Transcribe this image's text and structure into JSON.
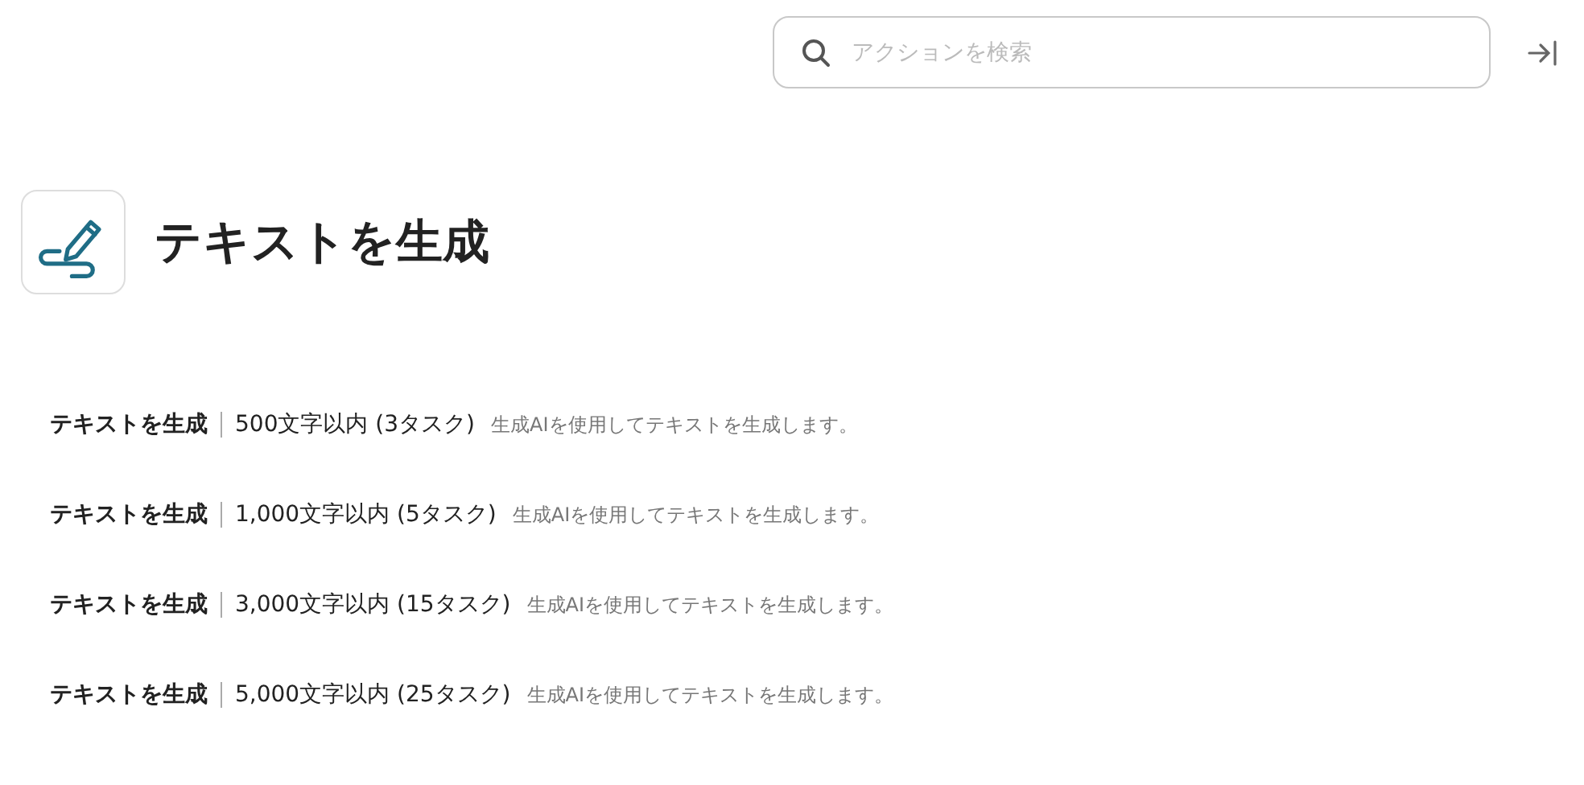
{
  "search": {
    "placeholder": "アクションを検索"
  },
  "header": {
    "title": "テキストを生成"
  },
  "actions": [
    {
      "name": "テキストを生成",
      "detail": "500文字以内 (3タスク)",
      "description": "生成AIを使用してテキストを生成します。"
    },
    {
      "name": "テキストを生成",
      "detail": "1,000文字以内 (5タスク)",
      "description": "生成AIを使用してテキストを生成します。"
    },
    {
      "name": "テキストを生成",
      "detail": "3,000文字以内 (15タスク)",
      "description": "生成AIを使用してテキストを生成します。"
    },
    {
      "name": "テキストを生成",
      "detail": "5,000文字以内 (25タスク)",
      "description": "生成AIを使用してテキストを生成します。"
    }
  ]
}
